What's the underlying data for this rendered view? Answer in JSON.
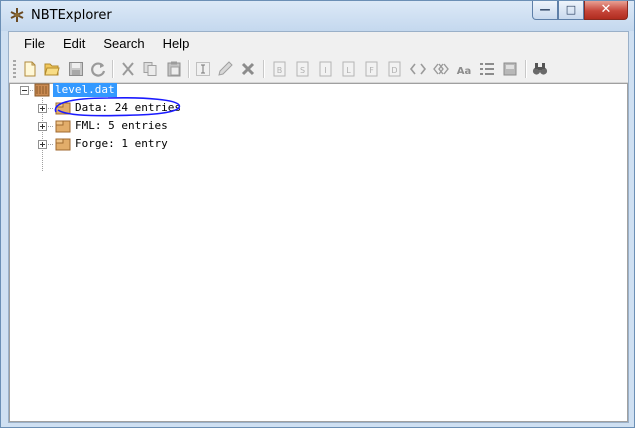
{
  "window": {
    "title": "NBTExplorer",
    "controls": {
      "minimize": "—",
      "maximize": "□",
      "close": "✕"
    }
  },
  "menubar": {
    "items": [
      "File",
      "Edit",
      "Search",
      "Help"
    ]
  },
  "toolbar": {
    "icons": [
      "new-file-icon",
      "open-folder-icon",
      "save-icon",
      "refresh-icon",
      "cut-icon",
      "copy-icon",
      "paste-icon",
      "rename-icon",
      "edit-icon",
      "delete-icon",
      "add-byte-tag-icon",
      "add-short-tag-icon",
      "add-int-tag-icon",
      "add-long-tag-icon",
      "add-float-tag-icon",
      "add-double-tag-icon",
      "add-byte-array-tag-icon",
      "add-int-array-tag-icon",
      "add-string-tag-icon",
      "add-list-tag-icon",
      "add-compound-tag-icon",
      "find-icon"
    ],
    "glyphs": {
      "byte": "B",
      "short": "S",
      "int": "I",
      "long": "L",
      "float": "F",
      "double": "D",
      "string": "Aa"
    }
  },
  "tree": {
    "root": {
      "label": "level.dat",
      "expanded": true,
      "selected": true
    },
    "children": [
      {
        "label": "Data: 24 entries",
        "expanded": false
      },
      {
        "label": "FML: 5 entries",
        "expanded": false
      },
      {
        "label": "Forge: 1 entry",
        "expanded": false
      }
    ]
  },
  "colors": {
    "selection": "#3399ff",
    "annotation_stroke": "#1a1aff",
    "folder": "#d9a35a"
  }
}
